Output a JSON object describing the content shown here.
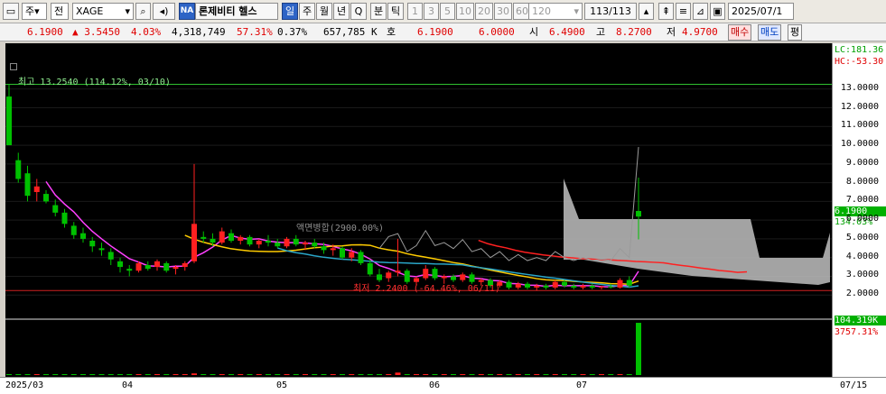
{
  "toolbar": {
    "type_select": "주",
    "market_select": "전",
    "symbol": "XAGE",
    "badge": "NA",
    "stock_name": "론제비티 헬스",
    "periods": [
      "일",
      "주",
      "월",
      "년",
      "Q",
      "분",
      "틱"
    ],
    "minute_values": [
      "1",
      "3",
      "5",
      "10",
      "20",
      "30",
      "60",
      "120"
    ],
    "count": "113/113",
    "date": "2025/07/1"
  },
  "quote": {
    "price": "6.1900",
    "change": "▲ 3.5450",
    "change_pct": "4.03%",
    "volume": "4,318,749",
    "vol_pct": "57.31%",
    "turnover_pct": "0.37%",
    "amount": "657,785 K",
    "ask_label": "호",
    "ask": "6.1900",
    "bid": "6.0000",
    "open_label": "시",
    "open": "6.4900",
    "high_label": "고",
    "high": "8.2700",
    "low_label": "저",
    "low": "4.9700",
    "buy_label": "매수",
    "sell_label": "매도",
    "avg_label": "평"
  },
  "annotations": {
    "high_label": "최고 13.2540 (114.12%, 03/10)",
    "low_label": "최저 2.2400 (-64.46%, 06/11)",
    "merge_label": "액면병합(2900.00%)",
    "lc": "LC:181.36",
    "hc": "HC:-53.30",
    "cur_price": "6.1900",
    "cur_pct": "134.03%",
    "vol_val": "104.319K",
    "vol_pct": "3757.31%"
  },
  "colors": {
    "up": "#ff2020",
    "down": "#00c000",
    "ma5": "#ff40ff",
    "ma20": "#ffcc00",
    "ma60": "#ff2020",
    "ma120": "#2aa6c8",
    "cloud": "#c0c0c0"
  },
  "chart_data": {
    "type": "candlestick",
    "y_ticks": [
      "13.0000",
      "12.0000",
      "11.0000",
      "10.0000",
      "9.0000",
      "8.0000",
      "7.0000",
      "6.0000",
      "5.0000",
      "4.0000",
      "3.0000",
      "2.0000"
    ],
    "ylim": [
      1.0,
      14.0
    ],
    "x_ticks": [
      "2025/03",
      "04",
      "05",
      "06",
      "07",
      "07/15"
    ],
    "price_ohlc": [
      [
        12.6,
        13.254,
        10.2,
        10.0
      ],
      [
        9.2,
        9.6,
        8.0,
        8.2
      ],
      [
        8.5,
        8.9,
        7.0,
        7.3
      ],
      [
        7.5,
        8.2,
        7.0,
        7.8
      ],
      [
        7.4,
        7.6,
        6.9,
        7.0
      ],
      [
        6.8,
        7.1,
        6.2,
        6.4
      ],
      [
        6.4,
        6.6,
        5.6,
        5.8
      ],
      [
        5.7,
        5.9,
        5.0,
        5.2
      ],
      [
        5.3,
        5.6,
        4.8,
        5.0
      ],
      [
        4.9,
        5.1,
        4.3,
        4.6
      ],
      [
        4.5,
        4.8,
        4.1,
        4.4
      ],
      [
        4.3,
        4.5,
        3.6,
        3.9
      ],
      [
        3.8,
        4.0,
        3.2,
        3.5
      ],
      [
        3.4,
        3.6,
        3.0,
        3.3
      ],
      [
        3.3,
        3.8,
        3.2,
        3.7
      ],
      [
        3.6,
        3.8,
        3.3,
        3.4
      ],
      [
        3.5,
        3.9,
        3.3,
        3.8
      ],
      [
        3.7,
        3.8,
        3.2,
        3.3
      ],
      [
        3.4,
        3.6,
        3.1,
        3.5
      ],
      [
        3.5,
        3.8,
        3.3,
        3.7
      ],
      [
        3.8,
        9.0,
        3.7,
        5.8
      ],
      [
        5.1,
        5.4,
        4.8,
        5.0
      ],
      [
        5.0,
        5.3,
        4.6,
        4.8
      ],
      [
        4.8,
        5.6,
        4.7,
        5.4
      ],
      [
        5.3,
        5.5,
        4.8,
        4.9
      ],
      [
        4.9,
        5.2,
        4.7,
        5.1
      ],
      [
        5.1,
        5.2,
        4.6,
        4.7
      ],
      [
        4.7,
        5.0,
        4.5,
        4.9
      ],
      [
        4.9,
        5.2,
        4.6,
        4.8
      ],
      [
        4.8,
        5.0,
        4.5,
        4.6
      ],
      [
        4.6,
        5.1,
        4.5,
        5.0
      ],
      [
        5.0,
        5.2,
        4.6,
        4.7
      ],
      [
        4.7,
        4.9,
        4.4,
        4.8
      ],
      [
        4.8,
        5.0,
        4.5,
        4.6
      ],
      [
        4.6,
        4.8,
        4.2,
        4.4
      ],
      [
        4.4,
        4.7,
        4.1,
        4.5
      ],
      [
        4.5,
        4.6,
        3.9,
        4.0
      ],
      [
        4.0,
        4.5,
        3.8,
        4.3
      ],
      [
        4.3,
        4.4,
        3.6,
        3.7
      ],
      [
        3.7,
        3.9,
        3.0,
        3.1
      ],
      [
        3.1,
        3.4,
        2.7,
        2.8
      ],
      [
        2.9,
        3.3,
        2.7,
        3.2
      ],
      [
        3.2,
        5.0,
        3.0,
        3.3
      ],
      [
        3.3,
        3.4,
        2.6,
        2.7
      ],
      [
        2.7,
        3.0,
        2.5,
        2.9
      ],
      [
        2.9,
        3.6,
        2.8,
        3.4
      ],
      [
        3.4,
        3.5,
        2.8,
        2.9
      ],
      [
        2.9,
        3.1,
        2.6,
        3.0
      ],
      [
        3.0,
        3.1,
        2.7,
        2.8
      ],
      [
        2.8,
        3.2,
        2.7,
        3.1
      ],
      [
        3.1,
        3.2,
        2.6,
        2.7
      ],
      [
        2.7,
        2.9,
        2.5,
        2.8
      ],
      [
        2.8,
        2.9,
        2.4,
        2.5
      ],
      [
        2.5,
        2.8,
        2.4,
        2.7
      ],
      [
        2.7,
        2.8,
        2.3,
        2.4
      ],
      [
        2.4,
        2.7,
        2.3,
        2.6
      ],
      [
        2.6,
        2.7,
        2.3,
        2.4
      ],
      [
        2.4,
        2.6,
        2.24,
        2.5
      ],
      [
        2.5,
        2.6,
        2.3,
        2.4
      ],
      [
        2.4,
        2.8,
        2.3,
        2.7
      ],
      [
        2.7,
        2.8,
        2.4,
        2.5
      ],
      [
        2.5,
        2.6,
        2.3,
        2.4
      ],
      [
        2.4,
        2.6,
        2.3,
        2.5
      ],
      [
        2.5,
        2.6,
        2.3,
        2.4
      ],
      [
        2.4,
        2.5,
        2.3,
        2.45
      ],
      [
        2.45,
        2.6,
        2.35,
        2.4
      ],
      [
        2.4,
        2.9,
        2.35,
        2.8
      ],
      [
        2.8,
        3.0,
        2.4,
        2.5
      ],
      [
        6.49,
        8.27,
        4.97,
        6.19
      ]
    ],
    "volume": [
      0.6,
      0.5,
      0.4,
      0.3,
      0.3,
      0.3,
      0.2,
      0.2,
      0.2,
      0.2,
      0.2,
      0.2,
      0.2,
      0.2,
      0.2,
      0.2,
      0.2,
      0.2,
      0.2,
      0.2,
      3.3,
      0.4,
      0.2,
      0.2,
      0.2,
      0.2,
      0.2,
      0.2,
      0.2,
      0.2,
      0.2,
      0.2,
      0.2,
      0.2,
      0.2,
      0.2,
      0.2,
      0.2,
      0.2,
      0.3,
      0.3,
      0.4,
      5.0,
      0.5,
      0.3,
      0.6,
      0.3,
      0.2,
      0.2,
      0.2,
      0.2,
      0.2,
      0.2,
      0.2,
      0.2,
      0.2,
      0.2,
      0.2,
      0.2,
      0.2,
      0.2,
      0.2,
      0.2,
      0.2,
      0.2,
      0.2,
      0.5,
      0.5,
      104.319
    ],
    "vol_ylim": [
      0,
      108
    ]
  }
}
